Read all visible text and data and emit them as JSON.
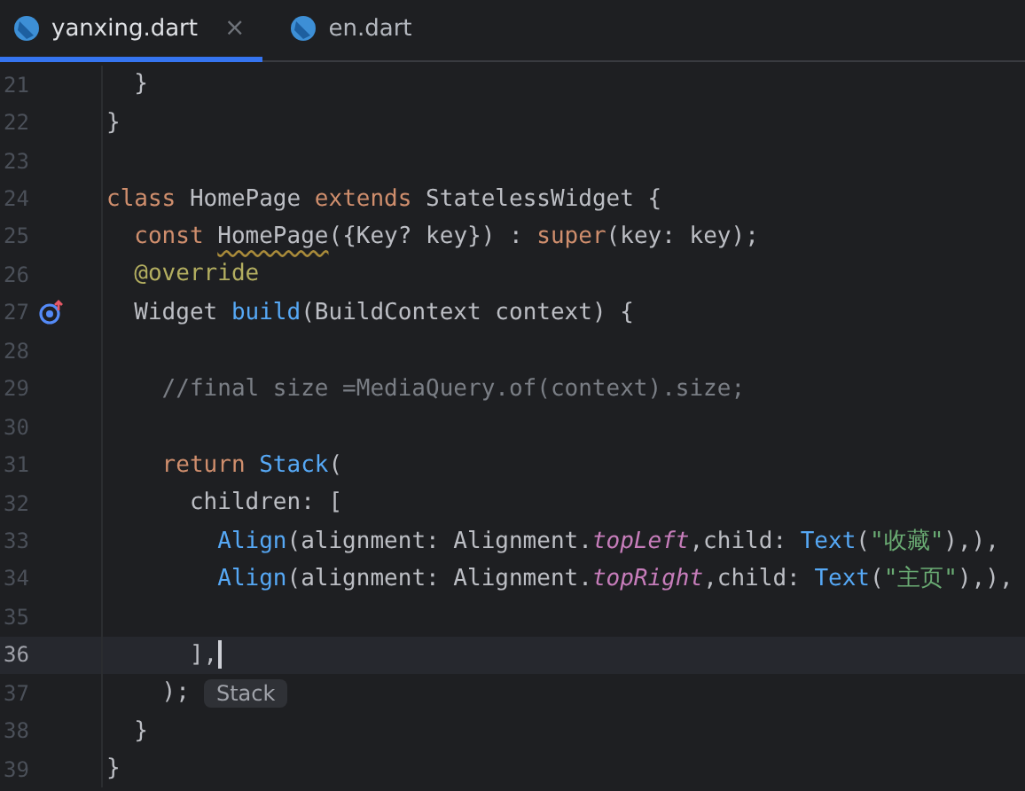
{
  "tabs": [
    {
      "label": "yanxing.dart",
      "selected": true,
      "close": "×"
    },
    {
      "label": "en.dart",
      "selected": false
    }
  ],
  "editor": {
    "lines": [
      {
        "number": "21",
        "current": false,
        "tokens": [
          {
            "kind": "plain",
            "text": "  }"
          }
        ]
      },
      {
        "number": "22",
        "current": false,
        "tokens": [
          {
            "kind": "plain",
            "text": "}"
          }
        ]
      },
      {
        "number": "23",
        "current": false
      },
      {
        "number": "24",
        "current": false,
        "tokens": [
          {
            "kind": "keyword",
            "text": "class "
          },
          {
            "kind": "plain",
            "text": "HomePage "
          },
          {
            "kind": "keyword",
            "text": "extends "
          },
          {
            "kind": "plain",
            "text": "StatelessWidget {"
          }
        ]
      },
      {
        "number": "25",
        "current": false,
        "tokens": [
          {
            "kind": "keyword",
            "text": "  const "
          },
          {
            "kind": "warning",
            "text": "HomePage"
          },
          {
            "kind": "plain",
            "text": "({Key? key}) : "
          },
          {
            "kind": "keyword",
            "text": "super"
          },
          {
            "kind": "plain",
            "text": "(key: key);"
          }
        ]
      },
      {
        "number": "26",
        "current": false,
        "tokens": [
          {
            "kind": "annotation",
            "text": "  @override"
          }
        ]
      },
      {
        "number": "27",
        "current": false,
        "override_marker": true,
        "tokens": [
          {
            "kind": "plain",
            "text": "  Widget "
          },
          {
            "kind": "function",
            "text": "build"
          },
          {
            "kind": "plain",
            "text": "(BuildContext context) {"
          }
        ]
      },
      {
        "number": "28",
        "current": false
      },
      {
        "number": "29",
        "current": false,
        "tokens": [
          {
            "kind": "comment",
            "text": "    //final size =MediaQuery.of(context).size;"
          }
        ]
      },
      {
        "number": "30",
        "current": false
      },
      {
        "number": "31",
        "current": false,
        "tokens": [
          {
            "kind": "keyword",
            "text": "    return "
          },
          {
            "kind": "function",
            "text": "Stack"
          },
          {
            "kind": "plain",
            "text": "("
          }
        ]
      },
      {
        "number": "32",
        "current": false,
        "tokens": [
          {
            "kind": "plain",
            "text": "      children: ["
          }
        ]
      },
      {
        "number": "33",
        "current": false,
        "tokens": [
          {
            "kind": "function",
            "text": "        Align"
          },
          {
            "kind": "plain",
            "text": "(alignment: Alignment."
          },
          {
            "kind": "field",
            "text": "topLeft"
          },
          {
            "kind": "plain",
            "text": ",child: "
          },
          {
            "kind": "function",
            "text": "Text"
          },
          {
            "kind": "plain",
            "text": "("
          },
          {
            "kind": "string",
            "text": "\"收藏\""
          },
          {
            "kind": "plain",
            "text": "),),"
          }
        ]
      },
      {
        "number": "34",
        "current": false,
        "tokens": [
          {
            "kind": "function",
            "text": "        Align"
          },
          {
            "kind": "plain",
            "text": "(alignment: Alignment."
          },
          {
            "kind": "field",
            "text": "topRight"
          },
          {
            "kind": "plain",
            "text": ",child: "
          },
          {
            "kind": "function",
            "text": "Text"
          },
          {
            "kind": "plain",
            "text": "("
          },
          {
            "kind": "string",
            "text": "\"主页\""
          },
          {
            "kind": "plain",
            "text": "),),"
          }
        ]
      },
      {
        "number": "35",
        "current": false
      },
      {
        "number": "36",
        "current": true,
        "tokens": [
          {
            "kind": "plain",
            "text": "      ],"
          }
        ]
      },
      {
        "number": "37",
        "current": false,
        "hint": "Stack",
        "tokens": [
          {
            "kind": "plain",
            "text": "    );"
          }
        ]
      },
      {
        "number": "38",
        "current": false,
        "tokens": [
          {
            "kind": "plain",
            "text": "  }"
          }
        ]
      },
      {
        "number": "39",
        "current": false,
        "tokens": [
          {
            "kind": "plain",
            "text": "}"
          }
        ]
      }
    ]
  }
}
